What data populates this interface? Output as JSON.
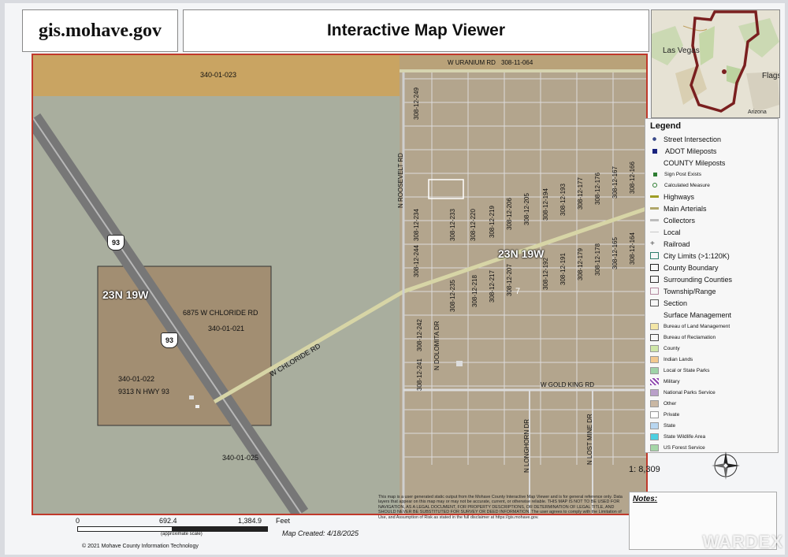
{
  "header": {
    "site": "gis.mohave.gov",
    "title": "Interactive Map Viewer"
  },
  "overview": {
    "labels": [
      "Las Vegas",
      "Flagstaff",
      "Arizona"
    ]
  },
  "map": {
    "parcels": {
      "top_strip": "340-01-023",
      "uranium_parcel": "308-11-064",
      "main": "340-01-021",
      "lower_left": "340-01-022",
      "bottom": "340-01-025"
    },
    "addresses": {
      "chloride": "6875 W CHLORIDE RD",
      "hwy": "9313 N HWY 93"
    },
    "highway_shield": "93",
    "township_labels": [
      "23N 19W",
      "23N 19W"
    ],
    "roads": {
      "uranium": "W URANIUM RD",
      "roosevelt": "N ROOSEVELT RD",
      "chloride": "W CHLORIDE RD",
      "gold_king": "W GOLD KING RD",
      "dolomite": "N DOLOMITA DR",
      "longhorn": "N LONGHORN DR",
      "lost_mine": "N LOST MINE DR"
    },
    "grid_parcels": [
      "308-12-249",
      "308-12-234",
      "308-12-233",
      "308-12-220",
      "308-12-219",
      "308-12-206",
      "308-12-205",
      "308-12-194",
      "308-12-193",
      "308-12-177",
      "308-12-176",
      "308-12-167",
      "308-12-166",
      "308-12-244",
      "308-12-235",
      "308-12-218",
      "308-12-217",
      "308-12-207",
      "308-12-192",
      "308-12-191",
      "308-12-179",
      "308-12-178",
      "308-12-165",
      "308-12-164",
      "308-12-242",
      "308-12-241"
    ],
    "section_number": "7"
  },
  "legend": {
    "title": "Legend",
    "items": [
      {
        "label": "Street Intersection",
        "swatch": "dot",
        "color": "#3b4a8a"
      },
      {
        "label": "ADOT Mileposts",
        "swatch": "square",
        "color": "#1a237e"
      },
      {
        "label": "COUNTY Mileposts",
        "swatch": "none",
        "color": ""
      },
      {
        "label": "Sign Post Exists",
        "swatch": "square-small",
        "color": "#2e7d32",
        "sub": true
      },
      {
        "label": "Calculated Measure",
        "swatch": "ring",
        "color": "#2e7d32",
        "sub": true
      },
      {
        "label": "Highways",
        "swatch": "line",
        "color": "#9e9d24"
      },
      {
        "label": "Main Arterials",
        "swatch": "line",
        "color": "#b0a66a"
      },
      {
        "label": "Collectors",
        "swatch": "line",
        "color": "#bdbdbd"
      },
      {
        "label": "Local",
        "swatch": "line-thin",
        "color": "#c8c8c8"
      },
      {
        "label": "Railroad",
        "swatch": "rail",
        "color": "#444"
      },
      {
        "label": "City Limits (>1:120K)",
        "swatch": "box",
        "color": "#2e7d6b"
      },
      {
        "label": "County Boundary",
        "swatch": "box",
        "color": "#222"
      },
      {
        "label": "Surrounding Counties",
        "swatch": "box",
        "color": "#333"
      },
      {
        "label": "Township/Range",
        "swatch": "box",
        "color": "#b48aa0"
      },
      {
        "label": "Section",
        "swatch": "box",
        "color": "#555"
      },
      {
        "label": "Surface Management",
        "swatch": "none",
        "color": ""
      },
      {
        "label": "Bureau of Land Management",
        "swatch": "fill",
        "color": "#f3e6a6",
        "sub": true
      },
      {
        "label": "Bureau of Reclamation",
        "swatch": "box",
        "color": "#444",
        "sub": true
      },
      {
        "label": "County",
        "swatch": "fill",
        "color": "#cfe7a8",
        "sub": true
      },
      {
        "label": "Indian Lands",
        "swatch": "fill",
        "color": "#f2c98f",
        "sub": true
      },
      {
        "label": "Local or State Parks",
        "swatch": "fill",
        "color": "#9fd3a8",
        "sub": true
      },
      {
        "label": "Military",
        "swatch": "hatch",
        "color": "#8e44ad",
        "sub": true
      },
      {
        "label": "National Parks Service",
        "swatch": "fill",
        "color": "#b9a0c9",
        "sub": true
      },
      {
        "label": "Other",
        "swatch": "fill",
        "color": "#c9b7a3",
        "sub": true
      },
      {
        "label": "Private",
        "swatch": "fill",
        "color": "#ffffff",
        "sub": true
      },
      {
        "label": "State",
        "swatch": "fill",
        "color": "#b8d6f0",
        "sub": true
      },
      {
        "label": "State Wildlife Area",
        "swatch": "fill",
        "color": "#4dd0e1",
        "sub": true
      },
      {
        "label": "US Forest Service",
        "swatch": "fill",
        "color": "#a5d6a7",
        "sub": true
      }
    ]
  },
  "scale": {
    "ratio": "1: 8,309",
    "ticks": [
      "0",
      "692.4",
      "1,384.9"
    ],
    "units": "Feet",
    "note": "(approximate scale)"
  },
  "notes_label": "Notes:",
  "map_created": "Map Created: 4/18/2025",
  "disclaimer": "This map is a user generated static output from the Mohave County Interactive Map Viewer and is for general reference only. Data layers that appear on this map may or may not be accurate, current, or otherwise reliable. THIS MAP IS NOT TO BE USED FOR NAVIGATION, AS A LEGAL DOCUMENT, FOR PROPERTY DESCRIPTIONS, OR DETERMINATION OF LEGAL TITLE, AND SHOULD NEVER BE SUBSTITUTED FOR SURVEY OR DEED INFORMATION. The user agrees to comply with the Limitation of Use, and Assumption of Risk as stated in the full disclaimer at https://gis.mohave.gov.",
  "copyright": "© 2021 Mohave County Information Technology",
  "watermark": "WARDEX"
}
